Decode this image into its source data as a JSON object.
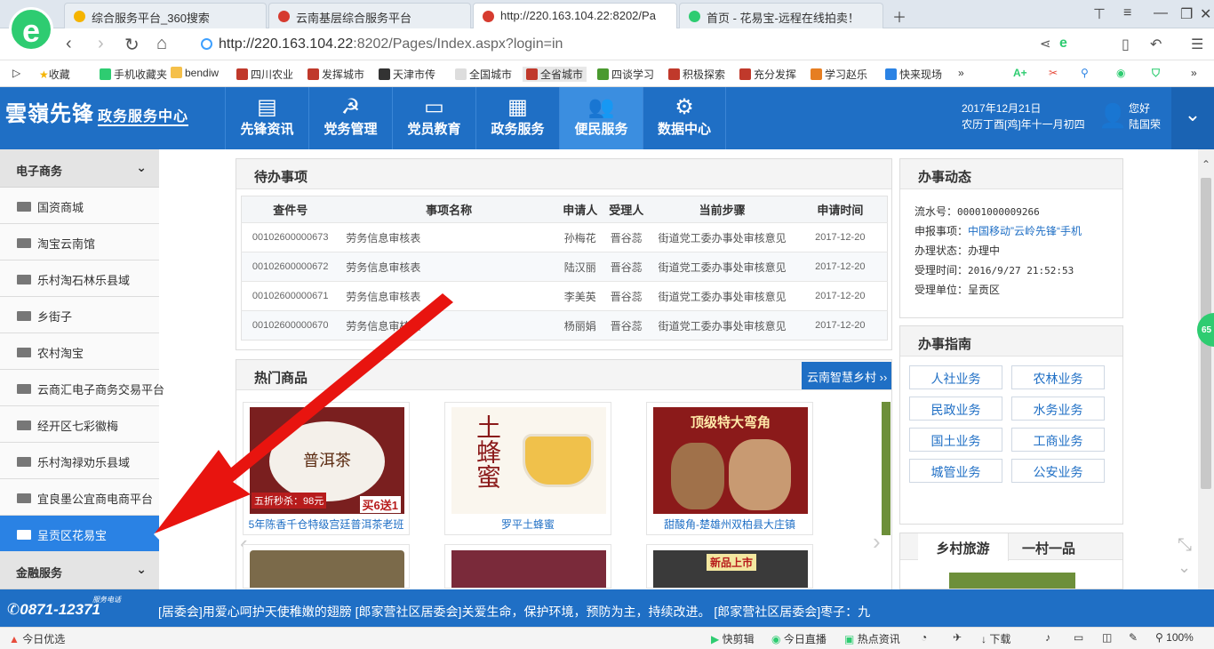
{
  "browser": {
    "tabs": [
      {
        "title": "综合服务平台_360搜索",
        "active": false
      },
      {
        "title": "云南基层综合服务平台",
        "active": false
      },
      {
        "title": "http://220.163.104.22:8202/Pa",
        "active": true
      },
      {
        "title": "首页 - 花易宝-远程在线拍卖！",
        "active": false
      }
    ],
    "url_host": "http://220.163.104.22",
    "url_rest": ":8202/Pages/Index.aspx?login=in",
    "bookmarks": [
      "收藏",
      "手机收藏夹",
      "bendiw",
      "四川农业",
      "发挥城市",
      "天津市传",
      "全国城市",
      "全省城市",
      "四谈学习",
      "积极探索",
      "充分发挥",
      "学习赵乐",
      "快来现场"
    ]
  },
  "site": {
    "brand": "雲嶺先锋",
    "brand_sub": "政务服务中心",
    "nav": [
      {
        "label": "先锋资讯",
        "icon": "news-icon"
      },
      {
        "label": "党务管理",
        "icon": "party-emblem-icon"
      },
      {
        "label": "党员教育",
        "icon": "monitor-icon"
      },
      {
        "label": "政务服务",
        "icon": "building-icon"
      },
      {
        "label": "便民服务",
        "icon": "people-icon",
        "active": true
      },
      {
        "label": "数据中心",
        "icon": "gear-icon"
      }
    ],
    "date_line1": "2017年12月21日",
    "date_line2": "农历丁酉[鸡]年十一月初四",
    "greeting": "您好",
    "username": "陆国荣"
  },
  "sidebar": {
    "group1": "电子商务",
    "items": [
      "国资商城",
      "淘宝云南馆",
      "乐村淘石林乐县域",
      "乡街子",
      "农村淘宝",
      "云商汇电子商务交易平台",
      "经开区七彩徽梅",
      "乐村淘禄劝乐县域",
      "宜良墨公宜商电商平台",
      "呈贡区花易宝"
    ],
    "active_index": 9,
    "group2": "金融服务"
  },
  "todo": {
    "title": "待办事项",
    "headers": [
      "查件号",
      "事项名称",
      "申请人",
      "受理人",
      "当前步骤",
      "申请时间"
    ],
    "rows": [
      [
        "00102600000673",
        "劳务信息审核表",
        "孙梅花",
        "晋谷蕊",
        "街道党工委办事处审核意见",
        "2017-12-20"
      ],
      [
        "00102600000672",
        "劳务信息审核表",
        "陆汉丽",
        "晋谷蕊",
        "街道党工委办事处审核意见",
        "2017-12-20"
      ],
      [
        "00102600000671",
        "劳务信息审核表",
        "李美英",
        "晋谷蕊",
        "街道党工委办事处审核意见",
        "2017-12-20"
      ],
      [
        "00102600000670",
        "劳务信息审核表",
        "杨丽娟",
        "晋谷蕊",
        "街道党工委办事处审核意见",
        "2017-12-20"
      ]
    ]
  },
  "hot": {
    "title": "热门商品",
    "button": "云南智慧乡村",
    "products": [
      {
        "caption": "5年陈香千仓特级宫廷普洱茶老班",
        "img_text": "普洱茶",
        "img_text2": "五折秒杀：98元",
        "img_text3": "买6送1",
        "color": "#7a1f1f"
      },
      {
        "caption": "罗平土蜂蜜",
        "img_text": "土蜂蜜",
        "color": "#f1e4c4"
      },
      {
        "caption": "甜酸角-楚雄州双柏县大庄镇",
        "img_text": "顶级特大弯角",
        "color": "#8b1a1a"
      }
    ],
    "row2_label": "新品上市"
  },
  "affairs": {
    "title": "办事动态",
    "fields": [
      {
        "k": "流水号：",
        "v": "00001000009266"
      },
      {
        "k": "申报事项：",
        "v": "中国移动”云岭先锋“手机"
      },
      {
        "k": "办理状态：",
        "v": "办理中"
      },
      {
        "k": "受理时间：",
        "v": "2016/9/27 21:52:53"
      },
      {
        "k": "受理单位：",
        "v": "呈贡区"
      }
    ]
  },
  "guide": {
    "title": "办事指南",
    "buttons": [
      "人社业务",
      "农林业务",
      "民政业务",
      "水务业务",
      "国土业务",
      "工商业务",
      "城管业务",
      "公安业务"
    ]
  },
  "tourism": {
    "tab1": "乡村旅游",
    "tab2": "一村一品"
  },
  "footer": {
    "phone_label": "服务电话",
    "phone": "0871-12371",
    "ticker": "[居委会]用爱心呵护天使稚嫩的翅膀   [郎家营社区居委会]关爱生命，保护环境，预防为主，持续改进。   [郎家营社区居委会]枣子：九"
  },
  "statusbar": {
    "left": "今日优选",
    "items": [
      "快剪辑",
      "今日直播",
      "热点资讯",
      "下载",
      "100%"
    ]
  },
  "side_badge": "65",
  "colors": {
    "brand_blue": "#1f6fc5",
    "active_item": "#2a82e4",
    "arrow_red": "#e8140f"
  }
}
